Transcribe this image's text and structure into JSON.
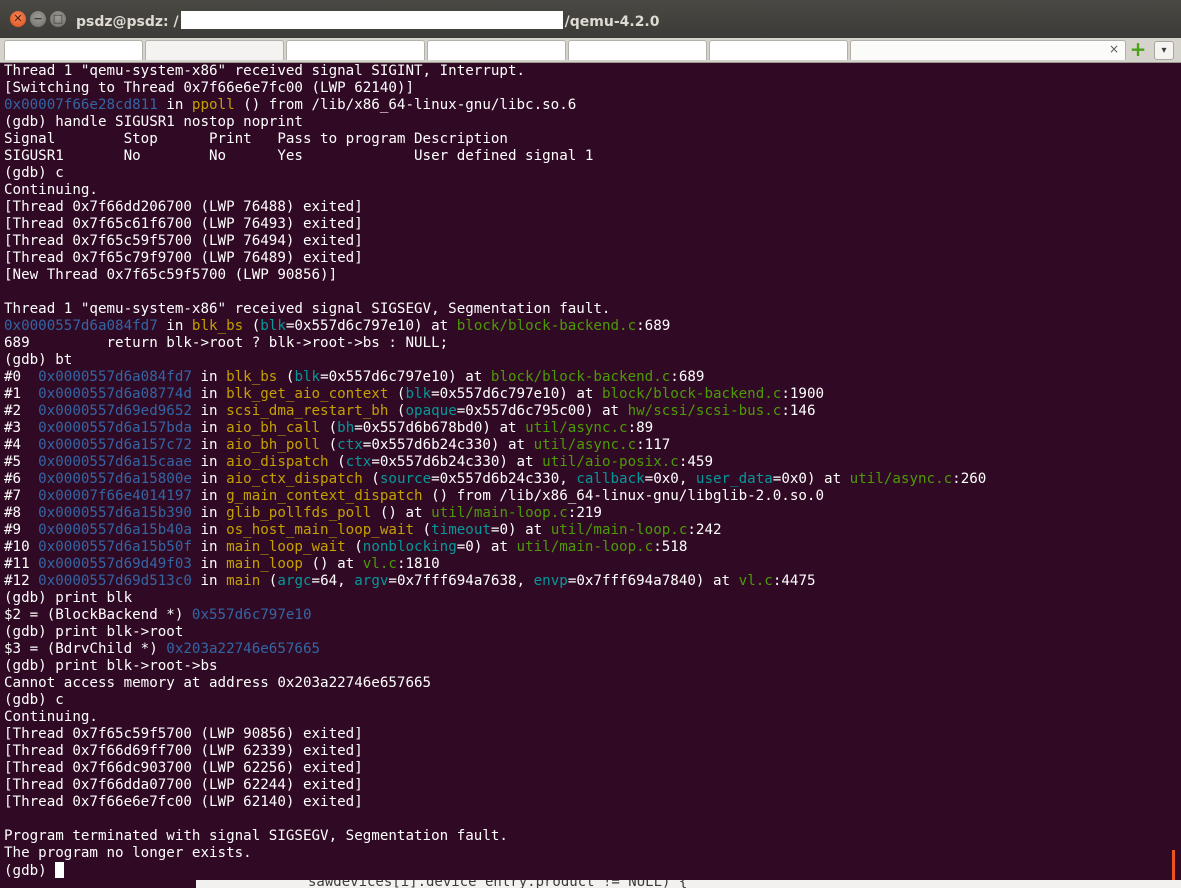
{
  "window": {
    "title_prefix": "psdz@psdz: /",
    "title_suffix": "/qemu-4.2.0",
    "close_glyph": "✕",
    "minimize_glyph": "−",
    "maximize_glyph": "□"
  },
  "tabs": {
    "close_glyph": "×",
    "add_glyph": "+",
    "menu_glyph": "▾"
  },
  "colors": {
    "terminal_bg": "#300a24",
    "text": "#ffffff",
    "address": "#3465a4",
    "function": "#c4a000",
    "file": "#4e9a06",
    "param": "#06989a",
    "accent": "#e95420"
  },
  "lines": [
    {
      "segments": [
        {
          "t": "Thread 1 \"qemu-system-x86\" received signal SIGINT, Interrupt."
        }
      ]
    },
    {
      "segments": [
        {
          "t": "[Switching to Thread 0x7f66e6e7fc00 (LWP 62140)]"
        }
      ]
    },
    {
      "segments": [
        {
          "t": "0x00007f66e28cd811",
          "c": "blue"
        },
        {
          "t": " in "
        },
        {
          "t": "ppoll",
          "c": "yellow"
        },
        {
          "t": " () from /lib/x86_64-linux-gnu/libc.so.6"
        }
      ]
    },
    {
      "segments": [
        {
          "t": "(gdb) handle SIGUSR1 nostop noprint"
        }
      ]
    },
    {
      "segments": [
        {
          "t": "Signal        Stop      Print   Pass to program Description"
        }
      ]
    },
    {
      "segments": [
        {
          "t": "SIGUSR1       No        No      Yes             User defined signal 1"
        }
      ]
    },
    {
      "segments": [
        {
          "t": "(gdb) c"
        }
      ]
    },
    {
      "segments": [
        {
          "t": "Continuing."
        }
      ]
    },
    {
      "segments": [
        {
          "t": "[Thread 0x7f66dd206700 (LWP 76488) exited]"
        }
      ]
    },
    {
      "segments": [
        {
          "t": "[Thread 0x7f65c61f6700 (LWP 76493) exited]"
        }
      ]
    },
    {
      "segments": [
        {
          "t": "[Thread 0x7f65c59f5700 (LWP 76494) exited]"
        }
      ]
    },
    {
      "segments": [
        {
          "t": "[Thread 0x7f65c79f9700 (LWP 76489) exited]"
        }
      ]
    },
    {
      "segments": [
        {
          "t": "[New Thread 0x7f65c59f5700 (LWP 90856)]"
        }
      ]
    },
    {
      "segments": [
        {
          "t": ""
        }
      ]
    },
    {
      "segments": [
        {
          "t": "Thread 1 \"qemu-system-x86\" received signal SIGSEGV, Segmentation fault."
        }
      ]
    },
    {
      "segments": [
        {
          "t": "0x0000557d6a084fd7",
          "c": "blue"
        },
        {
          "t": " in "
        },
        {
          "t": "blk_bs",
          "c": "yellow"
        },
        {
          "t": " ("
        },
        {
          "t": "blk",
          "c": "cyan"
        },
        {
          "t": "=0x557d6c797e10) at "
        },
        {
          "t": "block/block-backend.c",
          "c": "green"
        },
        {
          "t": ":689"
        }
      ]
    },
    {
      "segments": [
        {
          "t": "689         return blk->root ? blk->root->bs : NULL;"
        }
      ]
    },
    {
      "segments": [
        {
          "t": "(gdb) bt"
        }
      ]
    },
    {
      "segments": [
        {
          "t": "#0  "
        },
        {
          "t": "0x0000557d6a084fd7",
          "c": "blue"
        },
        {
          "t": " in "
        },
        {
          "t": "blk_bs",
          "c": "yellow"
        },
        {
          "t": " ("
        },
        {
          "t": "blk",
          "c": "cyan"
        },
        {
          "t": "=0x557d6c797e10) at "
        },
        {
          "t": "block/block-backend.c",
          "c": "green"
        },
        {
          "t": ":689"
        }
      ]
    },
    {
      "segments": [
        {
          "t": "#1  "
        },
        {
          "t": "0x0000557d6a08774d",
          "c": "blue"
        },
        {
          "t": " in "
        },
        {
          "t": "blk_get_aio_context",
          "c": "yellow"
        },
        {
          "t": " ("
        },
        {
          "t": "blk",
          "c": "cyan"
        },
        {
          "t": "=0x557d6c797e10) at "
        },
        {
          "t": "block/block-backend.c",
          "c": "green"
        },
        {
          "t": ":1900"
        }
      ]
    },
    {
      "segments": [
        {
          "t": "#2  "
        },
        {
          "t": "0x0000557d69ed9652",
          "c": "blue"
        },
        {
          "t": " in "
        },
        {
          "t": "scsi_dma_restart_bh",
          "c": "yellow"
        },
        {
          "t": " ("
        },
        {
          "t": "opaque",
          "c": "cyan"
        },
        {
          "t": "=0x557d6c795c00) at "
        },
        {
          "t": "hw/scsi/scsi-bus.c",
          "c": "green"
        },
        {
          "t": ":146"
        }
      ]
    },
    {
      "segments": [
        {
          "t": "#3  "
        },
        {
          "t": "0x0000557d6a157bda",
          "c": "blue"
        },
        {
          "t": " in "
        },
        {
          "t": "aio_bh_call",
          "c": "yellow"
        },
        {
          "t": " ("
        },
        {
          "t": "bh",
          "c": "cyan"
        },
        {
          "t": "=0x557d6b678bd0) at "
        },
        {
          "t": "util/async.c",
          "c": "green"
        },
        {
          "t": ":89"
        }
      ]
    },
    {
      "segments": [
        {
          "t": "#4  "
        },
        {
          "t": "0x0000557d6a157c72",
          "c": "blue"
        },
        {
          "t": " in "
        },
        {
          "t": "aio_bh_poll",
          "c": "yellow"
        },
        {
          "t": " ("
        },
        {
          "t": "ctx",
          "c": "cyan"
        },
        {
          "t": "=0x557d6b24c330) at "
        },
        {
          "t": "util/async.c",
          "c": "green"
        },
        {
          "t": ":117"
        }
      ]
    },
    {
      "segments": [
        {
          "t": "#5  "
        },
        {
          "t": "0x0000557d6a15caae",
          "c": "blue"
        },
        {
          "t": " in "
        },
        {
          "t": "aio_dispatch",
          "c": "yellow"
        },
        {
          "t": " ("
        },
        {
          "t": "ctx",
          "c": "cyan"
        },
        {
          "t": "=0x557d6b24c330) at "
        },
        {
          "t": "util/aio-posix.c",
          "c": "green"
        },
        {
          "t": ":459"
        }
      ]
    },
    {
      "segments": [
        {
          "t": "#6  "
        },
        {
          "t": "0x0000557d6a15800e",
          "c": "blue"
        },
        {
          "t": " in "
        },
        {
          "t": "aio_ctx_dispatch",
          "c": "yellow"
        },
        {
          "t": " ("
        },
        {
          "t": "source",
          "c": "cyan"
        },
        {
          "t": "=0x557d6b24c330, "
        },
        {
          "t": "callback",
          "c": "cyan"
        },
        {
          "t": "=0x0, "
        },
        {
          "t": "user_data",
          "c": "cyan"
        },
        {
          "t": "=0x0) at "
        },
        {
          "t": "util/async.c",
          "c": "green"
        },
        {
          "t": ":260"
        }
      ]
    },
    {
      "segments": [
        {
          "t": "#7  "
        },
        {
          "t": "0x00007f66e4014197",
          "c": "blue"
        },
        {
          "t": " in "
        },
        {
          "t": "g_main_context_dispatch",
          "c": "yellow"
        },
        {
          "t": " () from /lib/x86_64-linux-gnu/libglib-2.0.so.0"
        }
      ]
    },
    {
      "segments": [
        {
          "t": "#8  "
        },
        {
          "t": "0x0000557d6a15b390",
          "c": "blue"
        },
        {
          "t": " in "
        },
        {
          "t": "glib_pollfds_poll",
          "c": "yellow"
        },
        {
          "t": " () at "
        },
        {
          "t": "util/main-loop.c",
          "c": "green"
        },
        {
          "t": ":219"
        }
      ]
    },
    {
      "segments": [
        {
          "t": "#9  "
        },
        {
          "t": "0x0000557d6a15b40a",
          "c": "blue"
        },
        {
          "t": " in "
        },
        {
          "t": "os_host_main_loop_wait",
          "c": "yellow"
        },
        {
          "t": " ("
        },
        {
          "t": "timeout",
          "c": "cyan"
        },
        {
          "t": "=0) at "
        },
        {
          "t": "util/main-loop.c",
          "c": "green"
        },
        {
          "t": ":242"
        }
      ]
    },
    {
      "segments": [
        {
          "t": "#10 "
        },
        {
          "t": "0x0000557d6a15b50f",
          "c": "blue"
        },
        {
          "t": " in "
        },
        {
          "t": "main_loop_wait",
          "c": "yellow"
        },
        {
          "t": " ("
        },
        {
          "t": "nonblocking",
          "c": "cyan"
        },
        {
          "t": "=0) at "
        },
        {
          "t": "util/main-loop.c",
          "c": "green"
        },
        {
          "t": ":518"
        }
      ]
    },
    {
      "segments": [
        {
          "t": "#11 "
        },
        {
          "t": "0x0000557d69d49f03",
          "c": "blue"
        },
        {
          "t": " in "
        },
        {
          "t": "main_loop",
          "c": "yellow"
        },
        {
          "t": " () at "
        },
        {
          "t": "vl.c",
          "c": "green"
        },
        {
          "t": ":1810"
        }
      ]
    },
    {
      "segments": [
        {
          "t": "#12 "
        },
        {
          "t": "0x0000557d69d513c0",
          "c": "blue"
        },
        {
          "t": " in "
        },
        {
          "t": "main",
          "c": "yellow"
        },
        {
          "t": " ("
        },
        {
          "t": "argc",
          "c": "cyan"
        },
        {
          "t": "=64, "
        },
        {
          "t": "argv",
          "c": "cyan"
        },
        {
          "t": "=0x7fff694a7638, "
        },
        {
          "t": "envp",
          "c": "cyan"
        },
        {
          "t": "=0x7fff694a7840) at "
        },
        {
          "t": "vl.c",
          "c": "green"
        },
        {
          "t": ":4475"
        }
      ]
    },
    {
      "segments": [
        {
          "t": "(gdb) print blk"
        }
      ]
    },
    {
      "segments": [
        {
          "t": "$2 = (BlockBackend *) "
        },
        {
          "t": "0x557d6c797e10",
          "c": "blue"
        }
      ]
    },
    {
      "segments": [
        {
          "t": "(gdb) print blk->root"
        }
      ]
    },
    {
      "segments": [
        {
          "t": "$3 = (BdrvChild *) "
        },
        {
          "t": "0x203a22746e657665",
          "c": "blue"
        }
      ]
    },
    {
      "segments": [
        {
          "t": "(gdb) print blk->root->bs"
        }
      ]
    },
    {
      "segments": [
        {
          "t": "Cannot access memory at address 0x203a22746e657665"
        }
      ]
    },
    {
      "segments": [
        {
          "t": "(gdb) c"
        }
      ]
    },
    {
      "segments": [
        {
          "t": "Continuing."
        }
      ]
    },
    {
      "segments": [
        {
          "t": "[Thread 0x7f65c59f5700 (LWP 90856) exited]"
        }
      ]
    },
    {
      "segments": [
        {
          "t": "[Thread 0x7f66d69ff700 (LWP 62339) exited]"
        }
      ]
    },
    {
      "segments": [
        {
          "t": "[Thread 0x7f66dc903700 (LWP 62256) exited]"
        }
      ]
    },
    {
      "segments": [
        {
          "t": "[Thread 0x7f66dda07700 (LWP 62244) exited]"
        }
      ]
    },
    {
      "segments": [
        {
          "t": "[Thread 0x7f66e6e7fc00 (LWP 62140) exited]"
        }
      ]
    },
    {
      "segments": [
        {
          "t": ""
        }
      ]
    },
    {
      "segments": [
        {
          "t": "Program terminated with signal SIGSEGV, Segmentation fault."
        }
      ]
    },
    {
      "segments": [
        {
          "t": "The program no longer exists."
        }
      ]
    },
    {
      "segments": [
        {
          "t": "(gdb) "
        }
      ],
      "cursor": true
    }
  ],
  "background_peek": "sawdevices[i].device_entry.product != NULL) {"
}
